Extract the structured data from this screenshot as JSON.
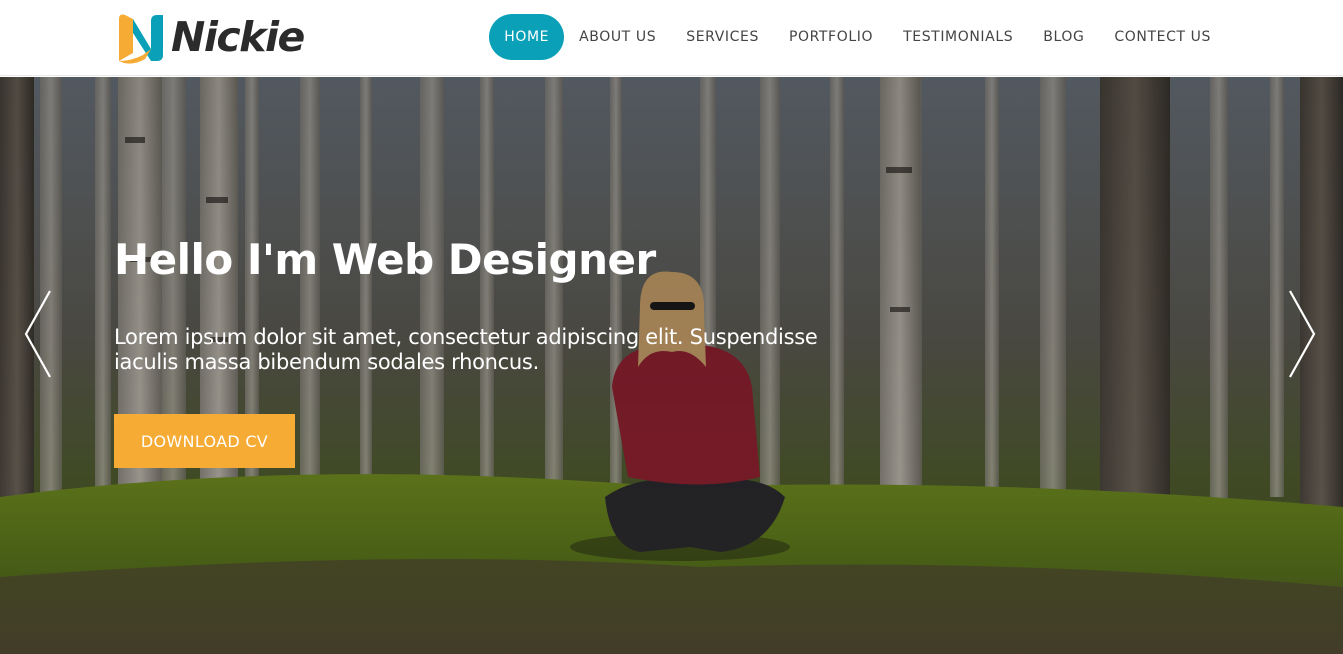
{
  "brand": {
    "name": "Nickie",
    "logo_icon": "n-logo-mark-icon",
    "colors": {
      "accent_teal": "#0aa1b8",
      "accent_orange": "#f6ab34",
      "text_dark": "#2b2b2b"
    }
  },
  "nav": {
    "items": [
      {
        "label": "HOME",
        "active": true
      },
      {
        "label": "ABOUT US",
        "active": false
      },
      {
        "label": "SERVICES",
        "active": false
      },
      {
        "label": "PORTFOLIO",
        "active": false
      },
      {
        "label": "TESTIMONIALS",
        "active": false
      },
      {
        "label": "BLOG",
        "active": false
      },
      {
        "label": "CONTECT US",
        "active": false
      }
    ]
  },
  "hero": {
    "title": "Hello I'm Web Designer",
    "description": "Lorem ipsum dolor sit amet, consectetur adipiscing elit. Suspendisse iaculis massa bibendum sodales rhoncus.",
    "cta_label": "DOWNLOAD CV",
    "prev_icon": "chevron-left-icon",
    "next_icon": "chevron-right-icon"
  }
}
